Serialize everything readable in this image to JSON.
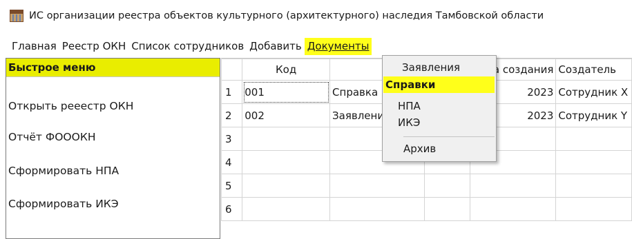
{
  "window": {
    "title": "ИС организации реестра объектов культурного (архитектурного) наследия Тамбовской области",
    "icon": "museum-building-icon"
  },
  "menubar": {
    "items": [
      "Главная",
      "Реестр ОКН",
      "Список сотрудников",
      "Добавить",
      "Документы"
    ],
    "active": "Документы"
  },
  "quick_menu": {
    "header": "Быстрое меню",
    "items": [
      "Открыть рееестр ОКН",
      "Отчёт ФОООКН",
      "Сформировать НПА",
      "Сформировать ИКЭ"
    ]
  },
  "grid": {
    "columns": [
      "Код",
      "",
      "",
      "Дата создания",
      "Создатель"
    ],
    "rows": [
      {
        "num": "1",
        "cells": [
          "001",
          "Справка",
          "",
          "2023",
          "Сотрудник X"
        ]
      },
      {
        "num": "2",
        "cells": [
          "002",
          "Заявление",
          "",
          "2023",
          "Сотрудник Y"
        ]
      },
      {
        "num": "3",
        "cells": [
          "",
          "",
          "",
          "",
          ""
        ]
      },
      {
        "num": "4",
        "cells": [
          "",
          "",
          "",
          "",
          ""
        ]
      },
      {
        "num": "5",
        "cells": [
          "",
          "",
          "",
          "",
          ""
        ]
      },
      {
        "num": "6",
        "cells": [
          "",
          "",
          "",
          "",
          ""
        ]
      }
    ]
  },
  "documents_menu": {
    "items": [
      "Заявления",
      "Справки",
      "НПА",
      "ИКЭ",
      "Архив"
    ],
    "highlighted": "Справки",
    "highlight_color": "#ffff1a"
  },
  "colors": {
    "menu_highlight": "#ffff1a",
    "quick_header_bg": "#e9ed00"
  }
}
